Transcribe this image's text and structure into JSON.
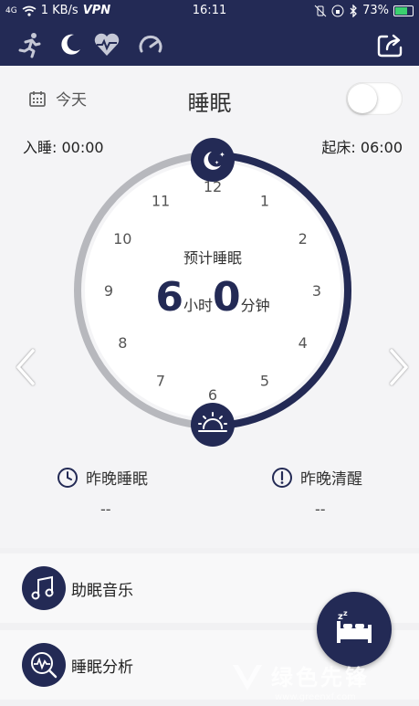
{
  "status_bar": {
    "signal": "4G",
    "speed": "1 KB/s",
    "vpn": "VPN",
    "time": "16:11",
    "battery": "73%"
  },
  "top_nav": {
    "icons": [
      "running-icon",
      "moon-icon",
      "heart-rate-icon",
      "gauge-icon",
      "share-icon"
    ]
  },
  "header": {
    "date_label": "今天",
    "title": "睡眠"
  },
  "schedule": {
    "sleep_label": "入睡: 00:00",
    "wake_label": "起床: 06:00"
  },
  "dial": {
    "center_label": "预计睡眠",
    "hours_value": "6",
    "hours_unit": "小时",
    "minutes_value": "0",
    "minutes_unit": "分钟",
    "numbers": [
      "12",
      "1",
      "2",
      "3",
      "4",
      "5",
      "6",
      "7",
      "8",
      "9",
      "10",
      "11"
    ],
    "sleep_arc_fraction": 0.5
  },
  "summary": {
    "last_night_sleep_label": "昨晚睡眠",
    "last_night_sleep_value": "--",
    "last_night_awake_label": "昨晚清醒",
    "last_night_awake_value": "--"
  },
  "features": {
    "music_label": "助眠音乐",
    "analysis_label": "睡眠分析"
  },
  "watermark": {
    "text": "绿色先锋",
    "url": "www.greenxf.com"
  },
  "colors": {
    "navy": "#232a55",
    "track_gray": "#b7b8bd",
    "background": "#f4f4f6"
  }
}
